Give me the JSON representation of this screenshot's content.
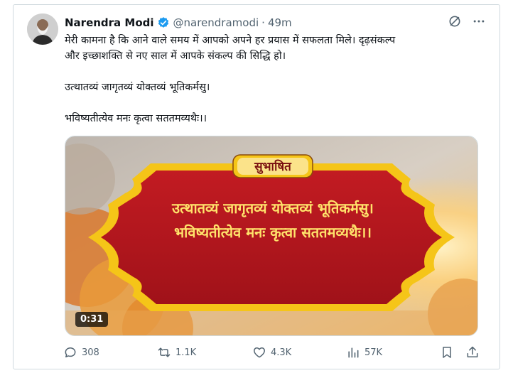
{
  "tweet": {
    "author_name": "Narendra Modi",
    "handle": "@narendramodi",
    "separator": "·",
    "time": "49m",
    "verified_icon": "verified-badge-icon",
    "lines": [
      "मेरी कामना है कि आने वाले समय में आपको अपने हर प्रयास में सफलता मिले। दृढ़संकल्प",
      "और इच्छाशक्ति से नए साल में आपके संकल्प की सिद्धि हो।",
      "उत्थातव्यं जागृतव्यं योक्तव्यं भूतिकर्मसु।",
      "भविष्यतीत्येव मनः कृत्वा सततमव्यथैः।।"
    ]
  },
  "media": {
    "banner_title": "सुभाषित",
    "verse_line1": "उत्थातव्यं जागृतव्यं योक्तव्यं भूतिकर्मसु।",
    "verse_line2": "भविष्यतीत्येव मनः कृत्वा सततमव्यथैः।।",
    "duration": "0:31",
    "colors": {
      "frame": "#f5c518",
      "panel": "#b0161e",
      "text": "#ffe36b"
    }
  },
  "actions": {
    "replies": "308",
    "reposts": "1.1K",
    "likes": "4.3K",
    "views": "57K"
  },
  "accent": "#1d9bf0"
}
